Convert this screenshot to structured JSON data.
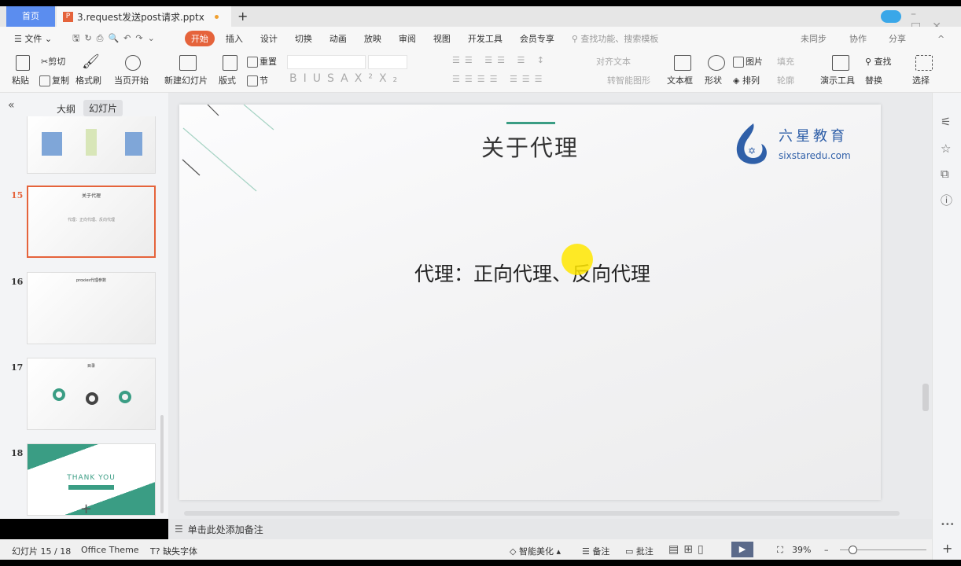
{
  "tabs": {
    "home": "首页",
    "document": "3.request发送post请求.pptx",
    "new_tab": "+"
  },
  "menu": {
    "file": "文件",
    "items": [
      "开始",
      "插入",
      "设计",
      "切换",
      "动画",
      "放映",
      "审阅",
      "视图",
      "开发工具",
      "会员专享"
    ],
    "search_placeholder": "查找功能、搜索模板",
    "right": [
      "未同步",
      "协作",
      "分享"
    ]
  },
  "ribbon": {
    "paste": "粘贴",
    "cut": "剪切",
    "copy": "复制",
    "format_painter": "格式刷",
    "play_current": "当页开始",
    "new_slide": "新建幻灯片",
    "layout": "版式",
    "reset": "重置",
    "section": "节",
    "align_text": "对齐文本",
    "smart_art": "转智能图形",
    "textbox": "文本框",
    "shape": "形状",
    "picture": "图片",
    "fill": "填充",
    "arrange": "排列",
    "outline": "轮廓",
    "present_tools": "演示工具",
    "find": "查找",
    "replace": "替换",
    "select": "选择",
    "font_styles": [
      "B",
      "I",
      "U",
      "S",
      "A",
      "X²",
      "X₂"
    ]
  },
  "left_panel": {
    "tab_outline": "大纲",
    "tab_slides": "幻灯片",
    "slides": [
      {
        "num": "15",
        "title": "关于代理",
        "body": "代理：正向代理、反向代理"
      },
      {
        "num": "16",
        "title": "proxies代理参数"
      },
      {
        "num": "17",
        "title": "目录"
      },
      {
        "num": "18",
        "title": "THANK YOU"
      }
    ],
    "add": "+"
  },
  "slide": {
    "title": "关于代理",
    "body": "代理：正向代理、反向代理",
    "logo_cn": "六星教育",
    "logo_en": "sixstaredu.com"
  },
  "notes_placeholder": "单击此处添加备注",
  "status": {
    "slide_count": "幻灯片 15 / 18",
    "theme": "Office Theme",
    "missing_font": "缺失字体",
    "beautify": "智能美化",
    "notes": "备注",
    "comments": "批注",
    "zoom": "39%"
  },
  "colors": {
    "accent": "#e5633b",
    "home_tab": "#5b8def",
    "slide_green": "#3a9d84",
    "logo_blue": "#2f5fa8"
  }
}
